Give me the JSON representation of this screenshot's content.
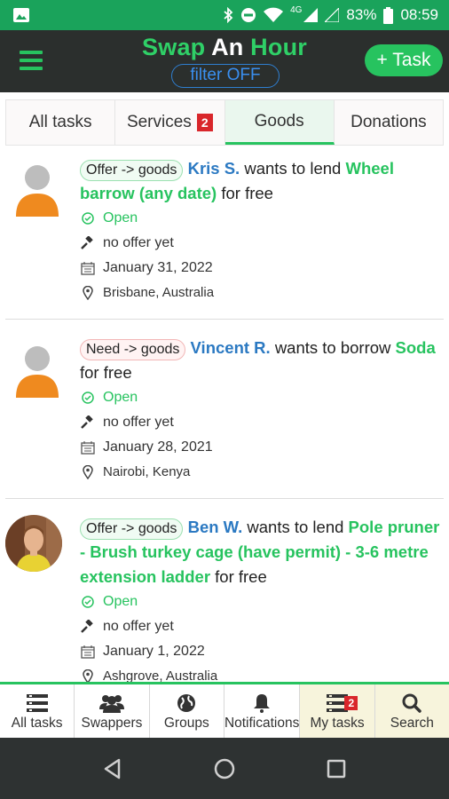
{
  "status_bar": {
    "network": "4G",
    "battery": "83%",
    "time": "08:59"
  },
  "header": {
    "title_part1": "Swap",
    "title_part2": "An",
    "title_part3": "Hour",
    "filter_label": "filter OFF",
    "add_task_label": "+ Task"
  },
  "tabs": [
    {
      "label": "All tasks",
      "badge": ""
    },
    {
      "label": "Services",
      "badge": "2"
    },
    {
      "label": "Goods",
      "badge": ""
    },
    {
      "label": "Donations",
      "badge": ""
    }
  ],
  "active_tab": "Goods",
  "tasks": [
    {
      "chip": "Offer -> goods",
      "user": "Kris S.",
      "verb": "wants to lend",
      "item": "Wheel barrow (any date)",
      "price": "for free",
      "status": "Open",
      "offers": "no offer yet",
      "date": "January 31, 2022",
      "location": "Brisbane, Australia"
    },
    {
      "chip": "Need -> goods",
      "user": "Vincent R.",
      "verb": "wants to borrow",
      "item": "Soda",
      "price": "for free",
      "status": "Open",
      "offers": "no offer yet",
      "date": "January 28, 2021",
      "location": "Nairobi, Kenya"
    },
    {
      "chip": "Offer -> goods",
      "user": "Ben W.",
      "verb": "wants to lend",
      "item": "Pole pruner - Brush turkey cage (have permit) - 3-6 metre extension ladder",
      "price": "for free",
      "status": "Open",
      "offers": "no offer yet",
      "date": "January 1, 2022",
      "location": "Ashgrove, Australia"
    }
  ],
  "bottom_nav": [
    {
      "label": "All tasks",
      "icon": "list-icon"
    },
    {
      "label": "Swappers",
      "icon": "users-icon"
    },
    {
      "label": "Groups",
      "icon": "globe-icon"
    },
    {
      "label": "Notifications",
      "icon": "bell-icon"
    },
    {
      "label": "My tasks",
      "icon": "list-icon",
      "badge": "2"
    },
    {
      "label": "Search",
      "icon": "search-icon"
    }
  ],
  "colors": {
    "brand_green": "#27c35f",
    "header_dark": "#2b2f2d",
    "link_blue": "#2b79c2",
    "badge_red": "#d9262b"
  }
}
